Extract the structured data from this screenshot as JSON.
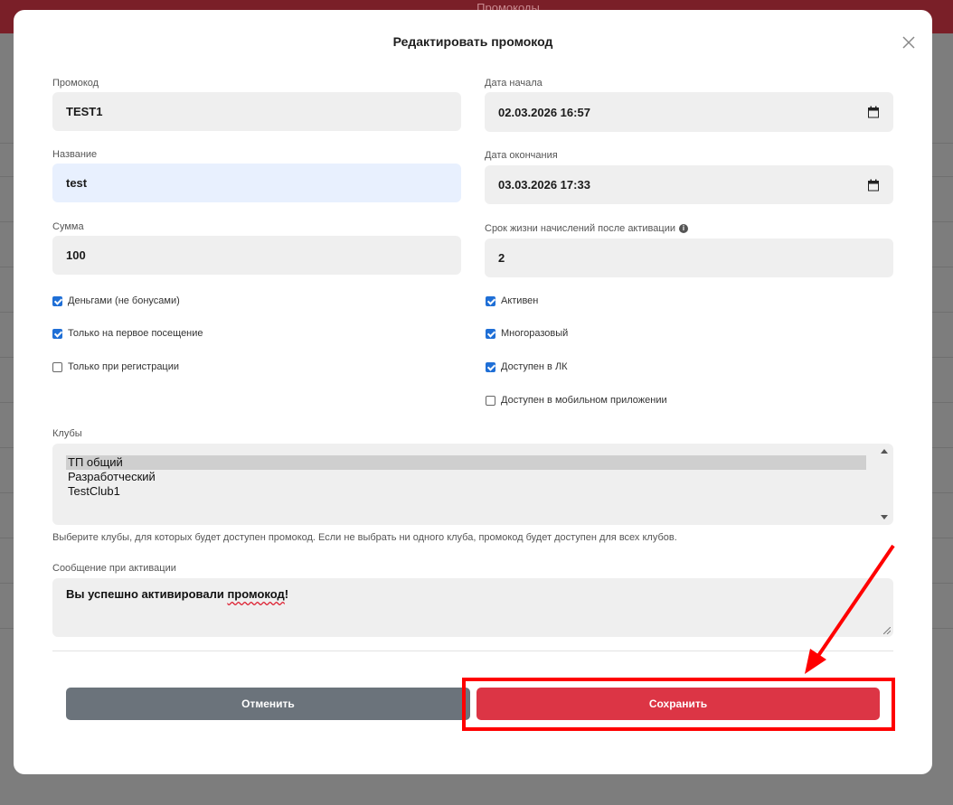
{
  "background": {
    "header_text": "Промокоды"
  },
  "modal": {
    "title": "Редактировать промокод",
    "close_icon": "close-icon"
  },
  "fields": {
    "promocode": {
      "label": "Промокод",
      "value": "TEST1"
    },
    "start_date": {
      "label": "Дата начала",
      "value": "02.03.2026 16:57"
    },
    "name": {
      "label": "Название",
      "value": "test"
    },
    "end_date": {
      "label": "Дата окончания",
      "value": "03.03.2026 17:33"
    },
    "amount": {
      "label": "Сумма",
      "value": "100"
    },
    "lifetime": {
      "label": "Срок жизни начислений после активации",
      "value": "2"
    }
  },
  "checkboxes_left": [
    {
      "label": "Деньгами (не бонусами)",
      "checked": true
    },
    {
      "label": "Только на первое посещение",
      "checked": true
    },
    {
      "label": "Только при регистрации",
      "checked": false
    }
  ],
  "checkboxes_right": [
    {
      "label": "Активен",
      "checked": true
    },
    {
      "label": "Многоразовый",
      "checked": true
    },
    {
      "label": "Доступен в ЛК",
      "checked": true
    },
    {
      "label": "Доступен в мобильном приложении",
      "checked": false
    }
  ],
  "clubs": {
    "label": "Клубы",
    "options": [
      "ТП общий",
      "Разработческий",
      "TestClub1"
    ],
    "selected": "ТП общий",
    "hint": "Выберите клубы, для которых будет доступен промокод. Если не выбрать ни одного клуба, промокод будет доступен для всех клубов."
  },
  "activation_message": {
    "label": "Сообщение при активации",
    "value_before": "Вы успешно активировали ",
    "value_misspelled": "промокод",
    "value_after": "!"
  },
  "buttons": {
    "cancel": "Отменить",
    "save": "Сохранить"
  },
  "colors": {
    "save": "#dc3545",
    "cancel": "#6b737b",
    "annotation": "#ff0000",
    "checkbox": "#1f6fd6"
  }
}
